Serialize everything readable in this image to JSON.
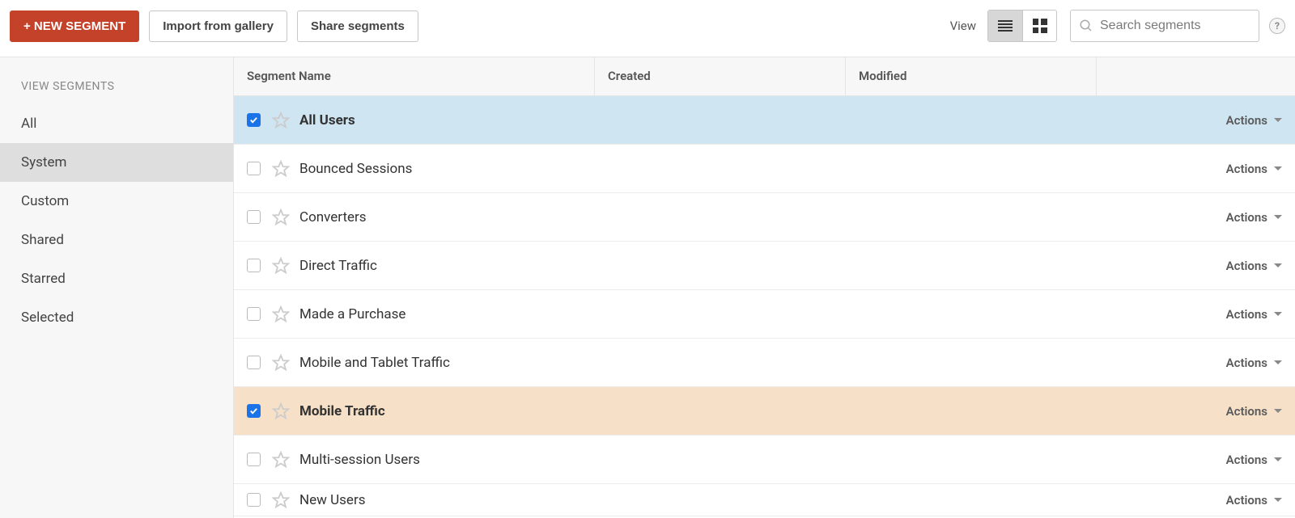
{
  "toolbar": {
    "new_segment": "+ New Segment",
    "import_gallery": "Import from gallery",
    "share_segments": "Share segments",
    "view_label": "View",
    "search_placeholder": "Search segments"
  },
  "sidebar": {
    "title": "VIEW SEGMENTS",
    "items": [
      "All",
      "System",
      "Custom",
      "Shared",
      "Starred",
      "Selected"
    ],
    "active_index": 1
  },
  "table": {
    "headers": {
      "name": "Segment Name",
      "created": "Created",
      "modified": "Modified"
    },
    "actions_label": "Actions",
    "rows": [
      {
        "name": "All Users",
        "checked": true,
        "highlight": "blue"
      },
      {
        "name": "Bounced Sessions",
        "checked": false,
        "highlight": "none"
      },
      {
        "name": "Converters",
        "checked": false,
        "highlight": "none"
      },
      {
        "name": "Direct Traffic",
        "checked": false,
        "highlight": "none"
      },
      {
        "name": "Made a Purchase",
        "checked": false,
        "highlight": "none"
      },
      {
        "name": "Mobile and Tablet Traffic",
        "checked": false,
        "highlight": "none"
      },
      {
        "name": "Mobile Traffic",
        "checked": true,
        "highlight": "orange"
      },
      {
        "name": "Multi-session Users",
        "checked": false,
        "highlight": "none"
      },
      {
        "name": "New Users",
        "checked": false,
        "highlight": "none",
        "partial": true
      }
    ]
  }
}
